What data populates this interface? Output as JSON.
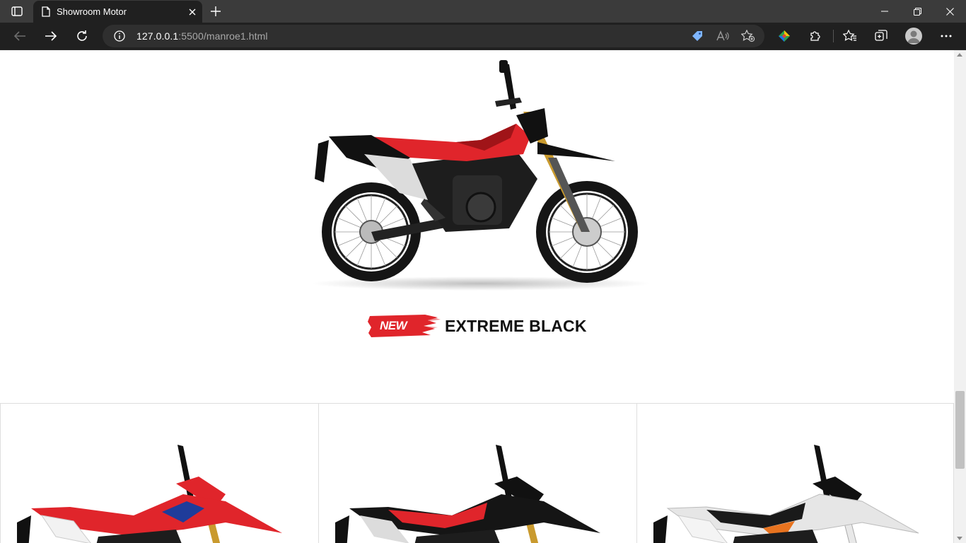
{
  "browser": {
    "tab_title": "Showroom Motor",
    "url_host": "127.0.0.1",
    "url_rest": ":5500/manroe1.html"
  },
  "hero": {
    "badge": "NEW",
    "variant_name": "EXTREME BLACK",
    "bike_color": "extreme-black"
  },
  "cards": [
    {
      "color_scheme": "red-white"
    },
    {
      "color_scheme": "black-red"
    },
    {
      "color_scheme": "black-white-orange"
    }
  ],
  "colors": {
    "badge_red": "#e0252b",
    "accent_gold": "#c99a2e"
  }
}
